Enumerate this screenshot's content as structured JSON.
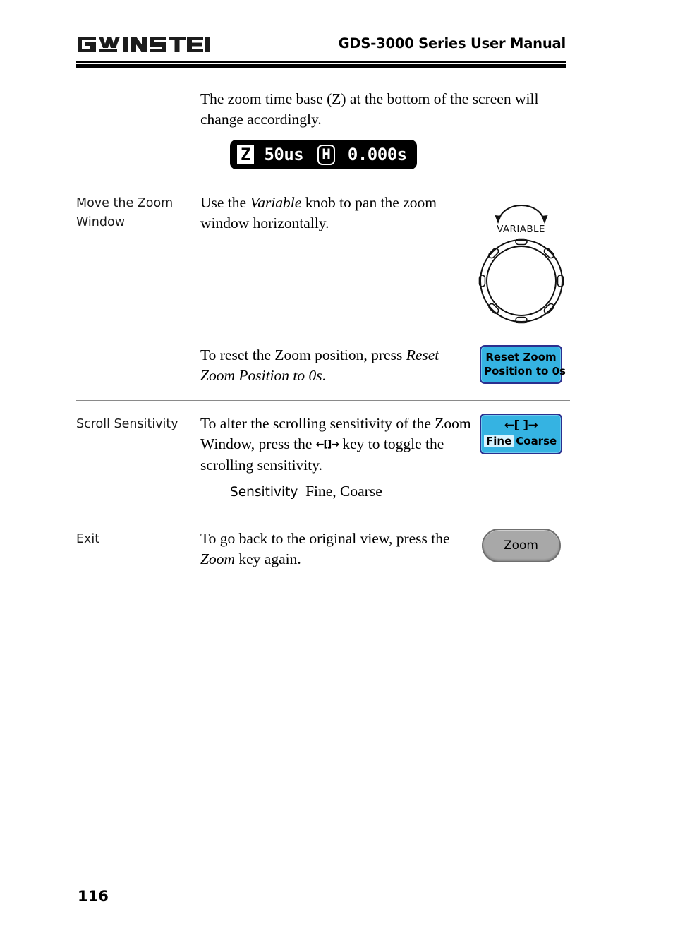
{
  "header": {
    "logo_text": "GW INSTEK",
    "title": "GDS-3000 Series User Manual"
  },
  "intro": {
    "text": "The zoom time base (Z) at the bottom of the screen will change accordingly."
  },
  "lcd_readout": {
    "badge": "Z",
    "timebase": "50us",
    "h_marker": "H",
    "position": "0.000s"
  },
  "rows": [
    {
      "label": "Move the Zoom Window",
      "body_prefix": "Use the ",
      "body_italic": "Variable",
      "body_suffix": " knob to pan the zoom window horizontally.",
      "figure": {
        "type": "variable-knob",
        "caption": "VARIABLE"
      }
    },
    {
      "label": "",
      "body_prefix": "To reset the Zoom position, press ",
      "body_italic": "Reset Zoom Position to 0s",
      "body_suffix": ".",
      "figure": {
        "type": "softkey",
        "line1": "Reset Zoom",
        "line2": "Position to 0s"
      }
    },
    {
      "label": "Scroll Sensitivity",
      "body_part1": "To alter the scrolling sensitivity of the Zoom Window, press the ",
      "body_glyph": "←[]→",
      "body_part2": " key to toggle the scrolling sensitivity.",
      "subnote_label": "Sensitivity",
      "subnote_values": "Fine, Coarse",
      "figure": {
        "type": "softkey-toggle",
        "arrows": "←[ ]→",
        "option_selected": "Fine",
        "option_other": "Coarse"
      }
    },
    {
      "label": "Exit",
      "body_prefix": "To go back to the original view, press the ",
      "body_italic": "Zoom",
      "body_suffix": " key again.",
      "figure": {
        "type": "hardkey",
        "label": "Zoom"
      }
    }
  ],
  "footer": {
    "page_number": "116"
  },
  "colors": {
    "softkey_fill": "#35b3e2",
    "softkey_border": "#2b2f8f",
    "hardkey_fill": "#a8a8a8",
    "lcd_background": "#000000",
    "divider": "#8a8a8a"
  }
}
